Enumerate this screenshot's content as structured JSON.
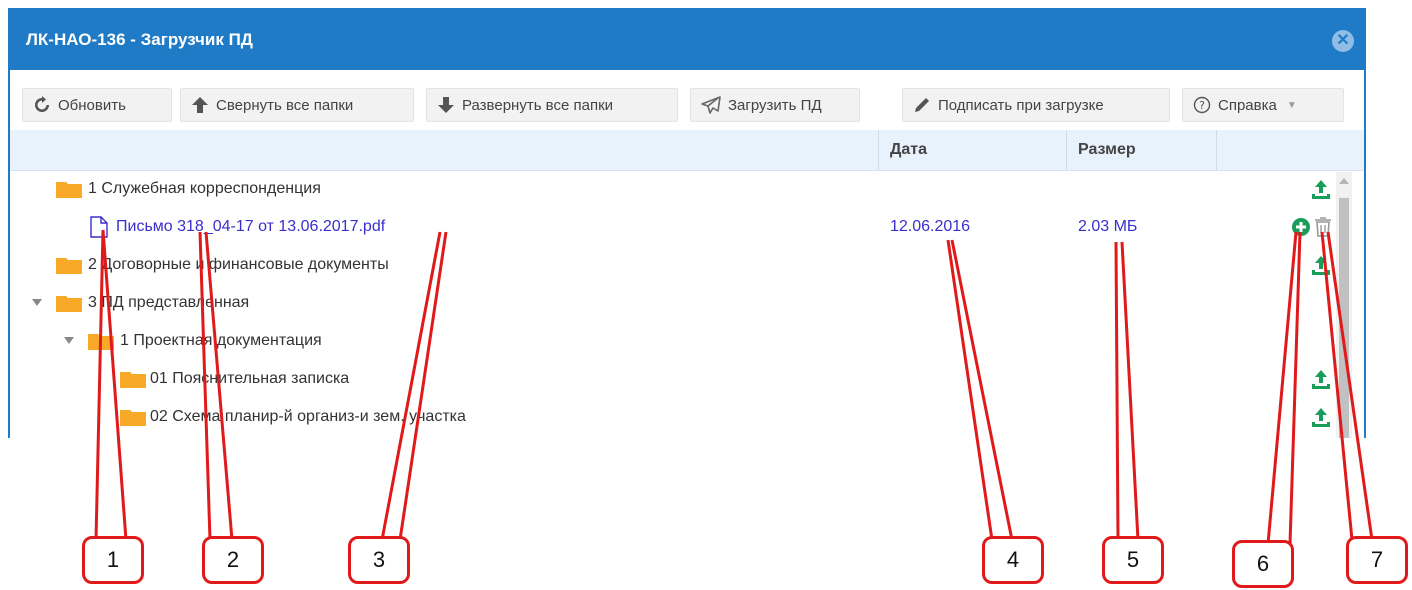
{
  "window": {
    "title": "ЛК-НАО-136 - Загрузчик ПД",
    "close_icon": "close-icon"
  },
  "toolbar": {
    "refresh_label": "Обновить",
    "collapse_label": "Свернуть все папки",
    "expand_label": "Развернуть все папки",
    "upload_label": "Загрузить ПД",
    "sign_label": "Подписать при загрузке",
    "help_label": "Справка"
  },
  "table": {
    "columns": [
      "Дата",
      "Размер"
    ]
  },
  "tree": {
    "folder1": "1 Служебная корреспонденция",
    "file1": {
      "name": "Письмо 318_04-17 от 13.06.2017.pdf",
      "date": "12.06.2016",
      "size": "2.03 МБ"
    },
    "folder2": "2 Договорные и финансовые документы",
    "folder3": "3 ПД представленная",
    "folder3_1": "1 Проектная документация",
    "folder3_1_1": "01 Пояснительная записка",
    "folder3_1_2": "02 Схема планир-й организ-и зем. участка"
  },
  "callouts": [
    "1",
    "2",
    "3",
    "4",
    "5",
    "6",
    "7"
  ],
  "colors": {
    "title_bar": "#1f7bc6",
    "link": "#3a2ecc",
    "folder": "#f8a928",
    "action_green": "#1a9c5a",
    "callout_red": "#e01a1a"
  }
}
